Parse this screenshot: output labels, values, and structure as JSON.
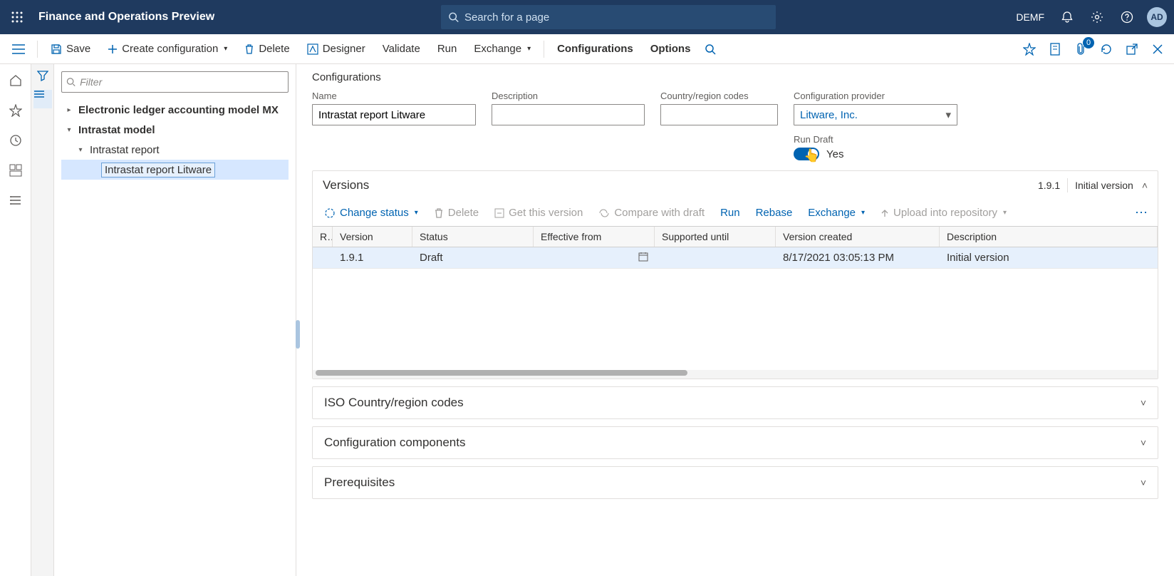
{
  "header": {
    "app_title": "Finance and Operations Preview",
    "search_placeholder": "Search for a page",
    "legal_entity": "DEMF",
    "avatar": "AD"
  },
  "command_bar": {
    "save": "Save",
    "create_config": "Create configuration",
    "delete": "Delete",
    "designer": "Designer",
    "validate": "Validate",
    "run": "Run",
    "exchange": "Exchange",
    "configurations": "Configurations",
    "options": "Options",
    "attach_count": "0"
  },
  "tree": {
    "filter_placeholder": "Filter",
    "items": [
      {
        "label": "Electronic ledger accounting model MX",
        "indent": 0,
        "expandable": true,
        "expanded": false,
        "bold": true
      },
      {
        "label": "Intrastat model",
        "indent": 0,
        "expandable": true,
        "expanded": true,
        "bold": true
      },
      {
        "label": "Intrastat report",
        "indent": 1,
        "expandable": true,
        "expanded": true,
        "bold": false
      },
      {
        "label": "Intrastat report Litware",
        "indent": 2,
        "expandable": false,
        "expanded": false,
        "bold": false,
        "selected": true
      }
    ]
  },
  "config_form": {
    "page_title": "Configurations",
    "name_label": "Name",
    "name_value": "Intrastat report Litware",
    "desc_label": "Description",
    "desc_value": "",
    "ccr_label": "Country/region codes",
    "ccr_value": "",
    "provider_label": "Configuration provider",
    "provider_value": "Litware, Inc.",
    "run_draft_label": "Run Draft",
    "run_draft_value": "Yes"
  },
  "versions": {
    "title": "Versions",
    "summary_version": "1.9.1",
    "summary_desc": "Initial version",
    "toolbar": {
      "change_status": "Change status",
      "delete": "Delete",
      "get_this_version": "Get this version",
      "compare": "Compare with draft",
      "run": "Run",
      "rebase": "Rebase",
      "exchange": "Exchange",
      "upload": "Upload into repository"
    },
    "columns": {
      "r": "R…",
      "version": "Version",
      "status": "Status",
      "effective": "Effective from",
      "supported": "Supported until",
      "created": "Version created",
      "desc": "Description"
    },
    "rows": [
      {
        "version": "1.9.1",
        "status": "Draft",
        "effective": "",
        "supported": "",
        "created": "8/17/2021 03:05:13 PM",
        "desc": "Initial version"
      }
    ]
  },
  "collapsed_sections": {
    "iso": "ISO Country/region codes",
    "components": "Configuration components",
    "prereq": "Prerequisites"
  }
}
